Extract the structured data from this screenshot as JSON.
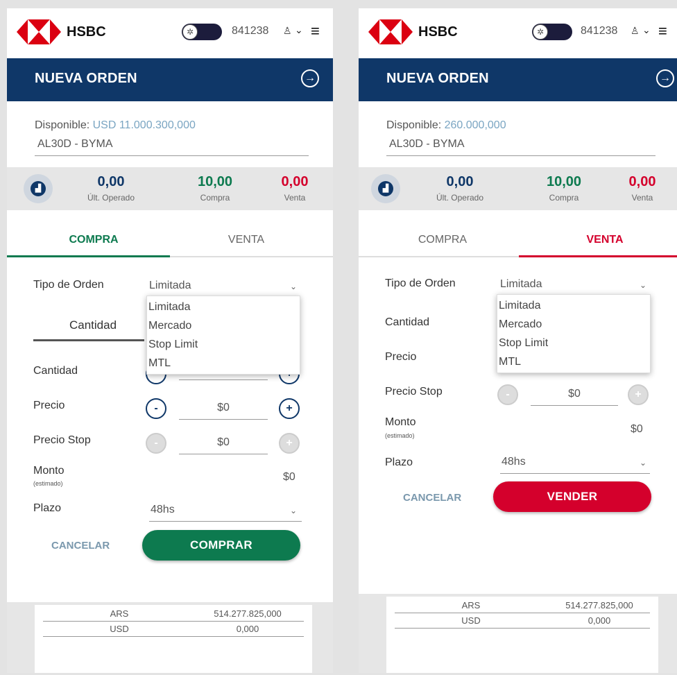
{
  "brand": "HSBC",
  "account_number": "841238",
  "page_title": "NUEVA ORDEN",
  "labels": {
    "disponible": "Disponible:",
    "tipo_orden": "Tipo de Orden",
    "cantidad": "Cantidad",
    "precio": "Precio",
    "precio_stop": "Precio Stop",
    "monto": "Monto",
    "estimado": "(estimado)",
    "plazo": "Plazo",
    "cancelar": "CANCELAR"
  },
  "quote": {
    "ult_operado_value": "0,00",
    "ult_operado_label": "Últ. Operado",
    "compra_value": "10,00",
    "compra_label": "Compra",
    "venta_value": "0,00",
    "venta_label": "Venta"
  },
  "tabs": {
    "compra": "COMPRA",
    "venta": "VENTA"
  },
  "order_types": [
    "Limitada",
    "Mercado",
    "Stop Limit",
    "MTL"
  ],
  "left": {
    "disponible_value": "USD 11.000.300,000",
    "instrument": "AL30D - BYMA",
    "tipo_selected": "Limitada",
    "subtab": "Cantidad",
    "precio_value": "$0",
    "precio_stop_value": "$0",
    "monto_value": "$0",
    "plazo_value": "48hs",
    "action_button": "COMPRAR"
  },
  "right": {
    "disponible_value": "260.000,000",
    "instrument": "AL30D - BYMA",
    "tipo_selected": "Limitada",
    "precio_stop_value": "$0",
    "monto_value": "$0",
    "plazo_value": "48hs",
    "action_button": "VENDER"
  },
  "balances": [
    {
      "currency": "ARS",
      "amount": "514.277.825,000"
    },
    {
      "currency": "USD",
      "amount": "0,000"
    }
  ],
  "colors": {
    "brand_red": "#db0011",
    "header_navy": "#0f3768",
    "buy_green": "#0d7a4f",
    "sell_red": "#d4002c",
    "muted_blue": "#7aa5c2"
  }
}
